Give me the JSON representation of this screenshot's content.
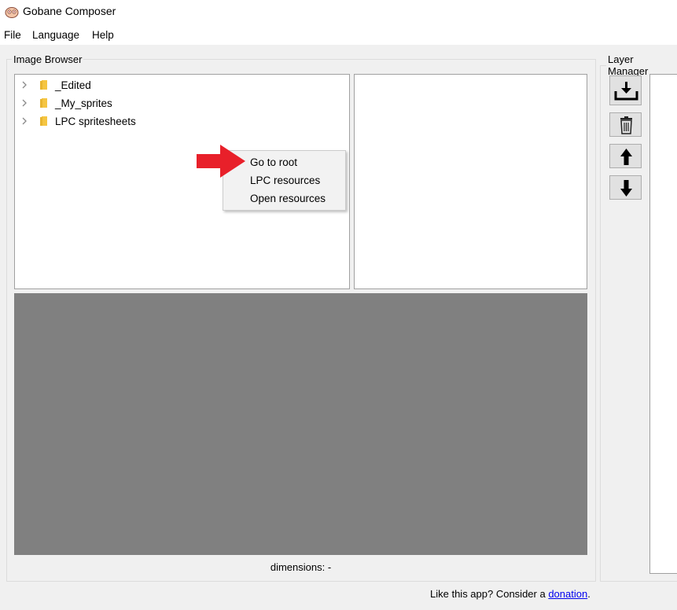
{
  "window": {
    "title": "Gobane Composer"
  },
  "menubar": {
    "items": [
      {
        "label": "File"
      },
      {
        "label": "Language"
      },
      {
        "label": "Help"
      }
    ]
  },
  "image_browser": {
    "title": "Image Browser",
    "tree": [
      {
        "label": "_Edited"
      },
      {
        "label": "_My_sprites"
      },
      {
        "label": "LPC spritesheets"
      }
    ],
    "context_menu": [
      {
        "label": "Go to root"
      },
      {
        "label": "LPC resources"
      },
      {
        "label": "Open resources"
      }
    ],
    "dimensions_label": "dimensions: -"
  },
  "layer_manager": {
    "title": "Layer Manager",
    "buttons": [
      "import-icon",
      "trash-icon",
      "arrow-up-icon",
      "arrow-down-icon"
    ]
  },
  "footer": {
    "prefix": "Like this app? Consider a ",
    "link": "donation",
    "suffix": "."
  },
  "colors": {
    "annotation_arrow": "#e8202a",
    "preview_bg": "#808080",
    "folder": "#f5c542"
  }
}
